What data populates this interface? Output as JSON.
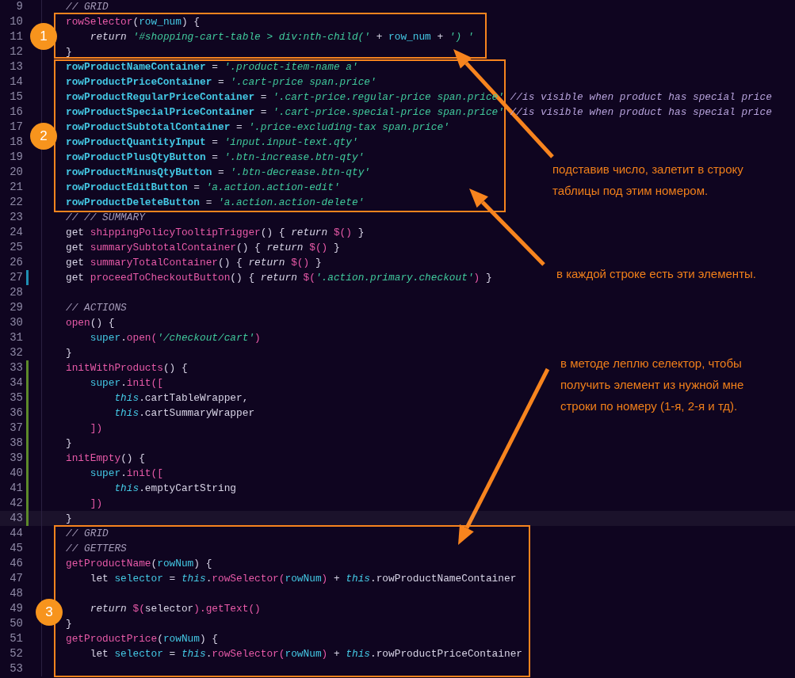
{
  "editor": {
    "lines": [
      {
        "number": "9",
        "current": false,
        "tokens": [
          {
            "kind": "comment",
            "text": "// GRID"
          }
        ]
      },
      {
        "number": "10",
        "current": false,
        "tokens": [
          {
            "kind": "method",
            "text": "rowSelector"
          },
          {
            "kind": "plain",
            "text": "("
          },
          {
            "kind": "var",
            "text": "row_num"
          },
          {
            "kind": "plain",
            "text": ") {"
          }
        ]
      },
      {
        "number": "11",
        "current": false,
        "tokens": [
          {
            "kind": "italic",
            "text": "    return "
          },
          {
            "kind": "string",
            "text": "'#shopping-cart-table > div:nth-child('"
          },
          {
            "kind": "plain",
            "text": " + "
          },
          {
            "kind": "var",
            "text": "row_num"
          },
          {
            "kind": "plain",
            "text": " + "
          },
          {
            "kind": "string",
            "text": "') '"
          }
        ]
      },
      {
        "number": "12",
        "current": false,
        "tokens": [
          {
            "kind": "plain",
            "text": "}"
          }
        ]
      },
      {
        "number": "13",
        "current": false,
        "tokens": [
          {
            "kind": "prop",
            "text": "rowProductNameContainer"
          },
          {
            "kind": "plain",
            "text": " = "
          },
          {
            "kind": "string",
            "text": "'.product-item-name a'"
          }
        ]
      },
      {
        "number": "14",
        "current": false,
        "tokens": [
          {
            "kind": "prop",
            "text": "rowProductPriceContainer"
          },
          {
            "kind": "plain",
            "text": " = "
          },
          {
            "kind": "string",
            "text": "'.cart-price span.price'"
          }
        ]
      },
      {
        "number": "15",
        "current": false,
        "tokens": [
          {
            "kind": "prop",
            "text": "rowProductRegularPriceContainer"
          },
          {
            "kind": "plain",
            "text": " = "
          },
          {
            "kind": "string",
            "text": "'.cart-price.regular-price span.price'"
          },
          {
            "kind": "comment2",
            "text": " //is visible when product has special price"
          }
        ]
      },
      {
        "number": "16",
        "current": false,
        "tokens": [
          {
            "kind": "prop",
            "text": "rowProductSpecialPriceContainer"
          },
          {
            "kind": "plain",
            "text": " = "
          },
          {
            "kind": "string",
            "text": "'.cart-price.special-price span.price'"
          },
          {
            "kind": "comment2",
            "text": " //is visible when product has special price"
          }
        ]
      },
      {
        "number": "17",
        "current": false,
        "tokens": [
          {
            "kind": "prop",
            "text": "rowProductSubtotalContainer"
          },
          {
            "kind": "plain",
            "text": " = "
          },
          {
            "kind": "string",
            "text": "'.price-excluding-tax span.price'"
          }
        ]
      },
      {
        "number": "18",
        "current": false,
        "tokens": [
          {
            "kind": "prop",
            "text": "rowProductQuantityInput"
          },
          {
            "kind": "plain",
            "text": " = "
          },
          {
            "kind": "string",
            "text": "'input.input-text.qty'"
          }
        ]
      },
      {
        "number": "19",
        "current": false,
        "tokens": [
          {
            "kind": "prop",
            "text": "rowProductPlusQtyButton"
          },
          {
            "kind": "plain",
            "text": " = "
          },
          {
            "kind": "string",
            "text": "'.btn-increase.btn-qty'"
          }
        ]
      },
      {
        "number": "20",
        "current": false,
        "tokens": [
          {
            "kind": "prop",
            "text": "rowProductMinusQtyButton"
          },
          {
            "kind": "plain",
            "text": " = "
          },
          {
            "kind": "string",
            "text": "'.btn-decrease.btn-qty'"
          }
        ]
      },
      {
        "number": "21",
        "current": false,
        "tokens": [
          {
            "kind": "prop",
            "text": "rowProductEditButton"
          },
          {
            "kind": "plain",
            "text": " = "
          },
          {
            "kind": "string",
            "text": "'a.action.action-edit'"
          }
        ]
      },
      {
        "number": "22",
        "current": false,
        "tokens": [
          {
            "kind": "prop",
            "text": "rowProductDeleteButton"
          },
          {
            "kind": "plain",
            "text": " = "
          },
          {
            "kind": "string",
            "text": "'a.action.action-delete'"
          }
        ]
      },
      {
        "number": "23",
        "current": false,
        "tokens": [
          {
            "kind": "comment",
            "text": "// // SUMMARY"
          }
        ]
      },
      {
        "number": "24",
        "current": false,
        "tokens": [
          {
            "kind": "plain",
            "text": "get "
          },
          {
            "kind": "method",
            "text": "shippingPolicyTooltipTrigger"
          },
          {
            "kind": "plain",
            "text": "() { "
          },
          {
            "kind": "italic",
            "text": "return "
          },
          {
            "kind": "method",
            "text": "$()"
          },
          {
            "kind": "plain",
            "text": " }"
          }
        ]
      },
      {
        "number": "25",
        "current": false,
        "tokens": [
          {
            "kind": "plain",
            "text": "get "
          },
          {
            "kind": "method",
            "text": "summarySubtotalContainer"
          },
          {
            "kind": "plain",
            "text": "() { "
          },
          {
            "kind": "italic",
            "text": "return "
          },
          {
            "kind": "method",
            "text": "$()"
          },
          {
            "kind": "plain",
            "text": " }"
          }
        ]
      },
      {
        "number": "26",
        "current": false,
        "tokens": [
          {
            "kind": "plain",
            "text": "get "
          },
          {
            "kind": "method",
            "text": "summaryTotalContainer"
          },
          {
            "kind": "plain",
            "text": "() { "
          },
          {
            "kind": "italic",
            "text": "return "
          },
          {
            "kind": "method",
            "text": "$()"
          },
          {
            "kind": "plain",
            "text": " }"
          }
        ]
      },
      {
        "number": "27",
        "color": "#1f8fb3",
        "current": false,
        "tokens": [
          {
            "kind": "plain",
            "text": "get "
          },
          {
            "kind": "method",
            "text": "proceedToCheckoutButton"
          },
          {
            "kind": "plain",
            "text": "() { "
          },
          {
            "kind": "italic",
            "text": "return "
          },
          {
            "kind": "method",
            "text": "$("
          },
          {
            "kind": "string",
            "text": "'.action.primary.checkout'"
          },
          {
            "kind": "method",
            "text": ")"
          },
          {
            "kind": "plain",
            "text": " }"
          }
        ]
      },
      {
        "number": "28",
        "current": false
      },
      {
        "number": "29",
        "current": false,
        "tokens": [
          {
            "kind": "comment",
            "text": "// ACTIONS"
          }
        ]
      },
      {
        "number": "30",
        "current": false,
        "tokens": [
          {
            "kind": "method",
            "text": "open"
          },
          {
            "kind": "plain",
            "text": "() {"
          }
        ]
      },
      {
        "number": "31",
        "current": false,
        "tokens": [
          {
            "kind": "var",
            "text": "    super"
          },
          {
            "kind": "plain",
            "text": "."
          },
          {
            "kind": "method",
            "text": "open("
          },
          {
            "kind": "string",
            "text": "'/checkout/cart'"
          },
          {
            "kind": "method",
            "text": ")"
          }
        ]
      },
      {
        "number": "32",
        "current": false,
        "tokens": [
          {
            "kind": "plain",
            "text": "}"
          }
        ]
      },
      {
        "number": "33",
        "color": "#5d8a2a",
        "current": false,
        "tokens": [
          {
            "kind": "method",
            "text": "initWithProducts"
          },
          {
            "kind": "plain",
            "text": "() {"
          }
        ]
      },
      {
        "number": "34",
        "color": "#5d8a2a",
        "current": false,
        "tokens": [
          {
            "kind": "var",
            "text": "    super"
          },
          {
            "kind": "plain",
            "text": "."
          },
          {
            "kind": "method",
            "text": "init(["
          }
        ]
      },
      {
        "number": "35",
        "color": "#5d8a2a",
        "current": false,
        "tokens": [
          {
            "kind": "this",
            "text": "        this"
          },
          {
            "kind": "plain",
            "text": ".cartTableWrapper,"
          }
        ]
      },
      {
        "number": "36",
        "color": "#5d8a2a",
        "current": false,
        "tokens": [
          {
            "kind": "this",
            "text": "        this"
          },
          {
            "kind": "plain",
            "text": ".cartSummaryWrapper"
          }
        ]
      },
      {
        "number": "37",
        "color": "#5d8a2a",
        "current": false,
        "tokens": [
          {
            "kind": "method",
            "text": "    ])"
          }
        ]
      },
      {
        "number": "38",
        "color": "#5d8a2a",
        "current": false,
        "tokens": [
          {
            "kind": "plain",
            "text": "}"
          }
        ]
      },
      {
        "number": "39",
        "color": "#5d8a2a",
        "current": false,
        "tokens": [
          {
            "kind": "method",
            "text": "initEmpty"
          },
          {
            "kind": "plain",
            "text": "() {"
          }
        ]
      },
      {
        "number": "40",
        "color": "#5d8a2a",
        "current": false,
        "tokens": [
          {
            "kind": "var",
            "text": "    super"
          },
          {
            "kind": "plain",
            "text": "."
          },
          {
            "kind": "method",
            "text": "init(["
          }
        ]
      },
      {
        "number": "41",
        "color": "#5d8a2a",
        "current": false,
        "tokens": [
          {
            "kind": "this",
            "text": "        this"
          },
          {
            "kind": "plain",
            "text": ".emptyCartString"
          }
        ]
      },
      {
        "number": "42",
        "color": "#5d8a2a",
        "current": false,
        "tokens": [
          {
            "kind": "method",
            "text": "    ])"
          }
        ]
      },
      {
        "number": "43",
        "color": "#5d8a2a",
        "current": true,
        "tokens": [
          {
            "kind": "plain",
            "text": "}"
          }
        ]
      },
      {
        "number": "44",
        "current": false,
        "tokens": [
          {
            "kind": "comment",
            "text": "// GRID"
          }
        ]
      },
      {
        "number": "45",
        "current": false,
        "tokens": [
          {
            "kind": "comment",
            "text": "// GETTERS"
          }
        ]
      },
      {
        "number": "46",
        "current": false,
        "tokens": [
          {
            "kind": "method",
            "text": "getProductName"
          },
          {
            "kind": "plain",
            "text": "("
          },
          {
            "kind": "var",
            "text": "rowNum"
          },
          {
            "kind": "plain",
            "text": ") {"
          }
        ]
      },
      {
        "number": "47",
        "current": false,
        "tokens": [
          {
            "kind": "plain",
            "text": "    let "
          },
          {
            "kind": "var",
            "text": "selector"
          },
          {
            "kind": "plain",
            "text": " = "
          },
          {
            "kind": "this",
            "text": "this"
          },
          {
            "kind": "plain",
            "text": "."
          },
          {
            "kind": "method",
            "text": "rowSelector("
          },
          {
            "kind": "var",
            "text": "rowNum"
          },
          {
            "kind": "method",
            "text": ")"
          },
          {
            "kind": "plain",
            "text": " + "
          },
          {
            "kind": "this",
            "text": "this"
          },
          {
            "kind": "plain",
            "text": ".rowProductNameContainer"
          }
        ]
      },
      {
        "number": "48",
        "current": false
      },
      {
        "number": "49",
        "current": false,
        "tokens": [
          {
            "kind": "italic",
            "text": "    return "
          },
          {
            "kind": "method",
            "text": "$("
          },
          {
            "kind": "plain",
            "text": "selector"
          },
          {
            "kind": "method",
            "text": ").getText()"
          }
        ]
      },
      {
        "number": "50",
        "current": false,
        "tokens": [
          {
            "kind": "plain",
            "text": "}"
          }
        ]
      },
      {
        "number": "51",
        "current": false,
        "tokens": [
          {
            "kind": "method",
            "text": "getProductPrice"
          },
          {
            "kind": "plain",
            "text": "("
          },
          {
            "kind": "var",
            "text": "rowNum"
          },
          {
            "kind": "plain",
            "text": ") {"
          }
        ]
      },
      {
        "number": "52",
        "current": false,
        "tokens": [
          {
            "kind": "plain",
            "text": "    let "
          },
          {
            "kind": "var",
            "text": "selector"
          },
          {
            "kind": "plain",
            "text": " = "
          },
          {
            "kind": "this",
            "text": "this"
          },
          {
            "kind": "plain",
            "text": "."
          },
          {
            "kind": "method",
            "text": "rowSelector("
          },
          {
            "kind": "var",
            "text": "rowNum"
          },
          {
            "kind": "method",
            "text": ")"
          },
          {
            "kind": "plain",
            "text": " + "
          },
          {
            "kind": "this",
            "text": "this"
          },
          {
            "kind": "plain",
            "text": ".rowProductPriceContainer"
          }
        ]
      },
      {
        "number": "53",
        "current": false
      }
    ]
  },
  "annotations": {
    "markers": [
      {
        "label": "1"
      },
      {
        "label": "2"
      },
      {
        "label": "3"
      }
    ],
    "notes": [
      {
        "text": "подставив число, залетит в строку таблицы под этим номером."
      },
      {
        "text": "в каждой строке есть эти элементы."
      },
      {
        "text": "в методе леплю селектор, чтобы получить элемент из нужной мне строки по номеру (1-я, 2-я и тд)."
      }
    ]
  }
}
